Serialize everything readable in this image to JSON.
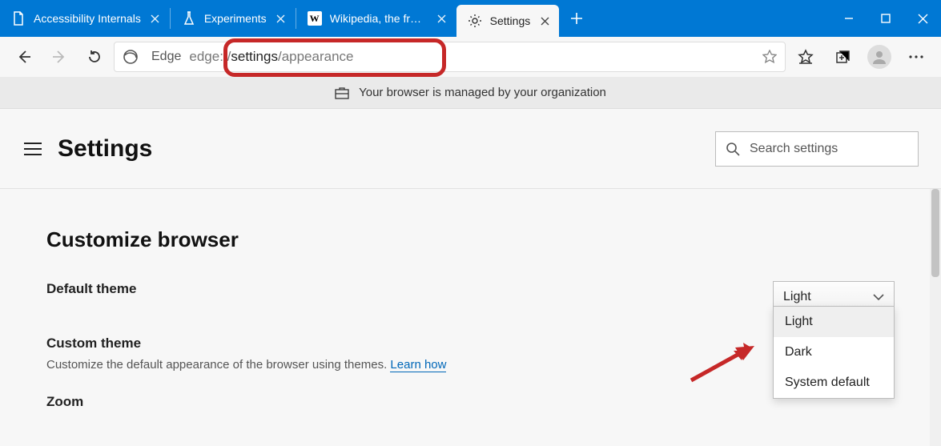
{
  "tabs": [
    {
      "label": "Accessibility Internals",
      "icon": "file-icon"
    },
    {
      "label": "Experiments",
      "icon": "flask-icon"
    },
    {
      "label": "Wikipedia, the free en",
      "icon": "wikipedia-icon"
    },
    {
      "label": "Settings",
      "icon": "gear-icon",
      "active": true
    }
  ],
  "address": {
    "engine_label": "Edge",
    "url_prefix": "edge://",
    "url_main": "settings",
    "url_suffix": "/appearance"
  },
  "managed_banner": "Your browser is managed by your organization",
  "settings_header": {
    "title": "Settings",
    "search_placeholder": "Search settings"
  },
  "appearance": {
    "section_title": "Customize browser",
    "default_theme_label": "Default theme",
    "custom_theme_label": "Custom theme",
    "custom_theme_sub": "Customize the default appearance of the browser using themes.",
    "learn_how": "Learn how",
    "zoom_label": "Zoom",
    "theme_selected": "Light",
    "theme_options": [
      "Light",
      "Dark",
      "System default"
    ]
  }
}
